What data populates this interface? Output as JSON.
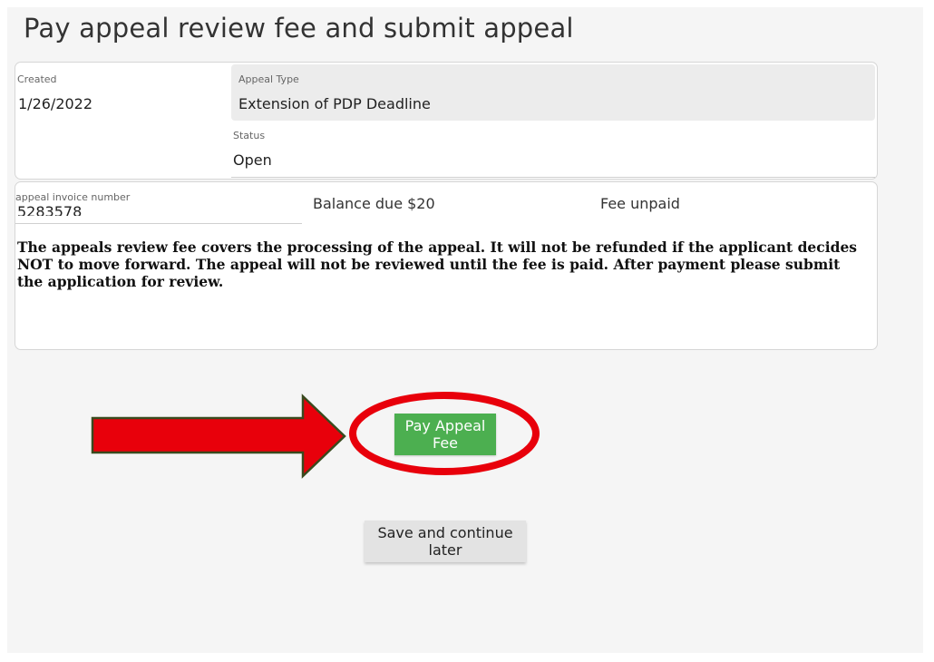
{
  "page": {
    "title": "Pay appeal review fee and submit appeal"
  },
  "appeal": {
    "created_label": "Created",
    "created_value": "1/26/2022",
    "type_label": "Appeal Type",
    "type_value": "Extension of PDP Deadline",
    "status_label": "Status",
    "status_value": "Open"
  },
  "invoice": {
    "number_label": "appeal invoice number",
    "number_value": "5283578",
    "balance": "Balance due $20",
    "fee_status": "Fee unpaid",
    "notice": "The appeals review fee covers the processing of the appeal.  It will not be refunded if the applicant decides NOT to move forward.  The appeal will not be reviewed until the fee is paid.  After payment please submit the application for review."
  },
  "actions": {
    "pay_label": "Pay Appeal Fee",
    "save_label": "Save and continue later"
  },
  "annotation": {
    "arrow_color": "#e8000b",
    "arrow_outline": "#3a4a1e",
    "circle_color": "#e8000b"
  }
}
